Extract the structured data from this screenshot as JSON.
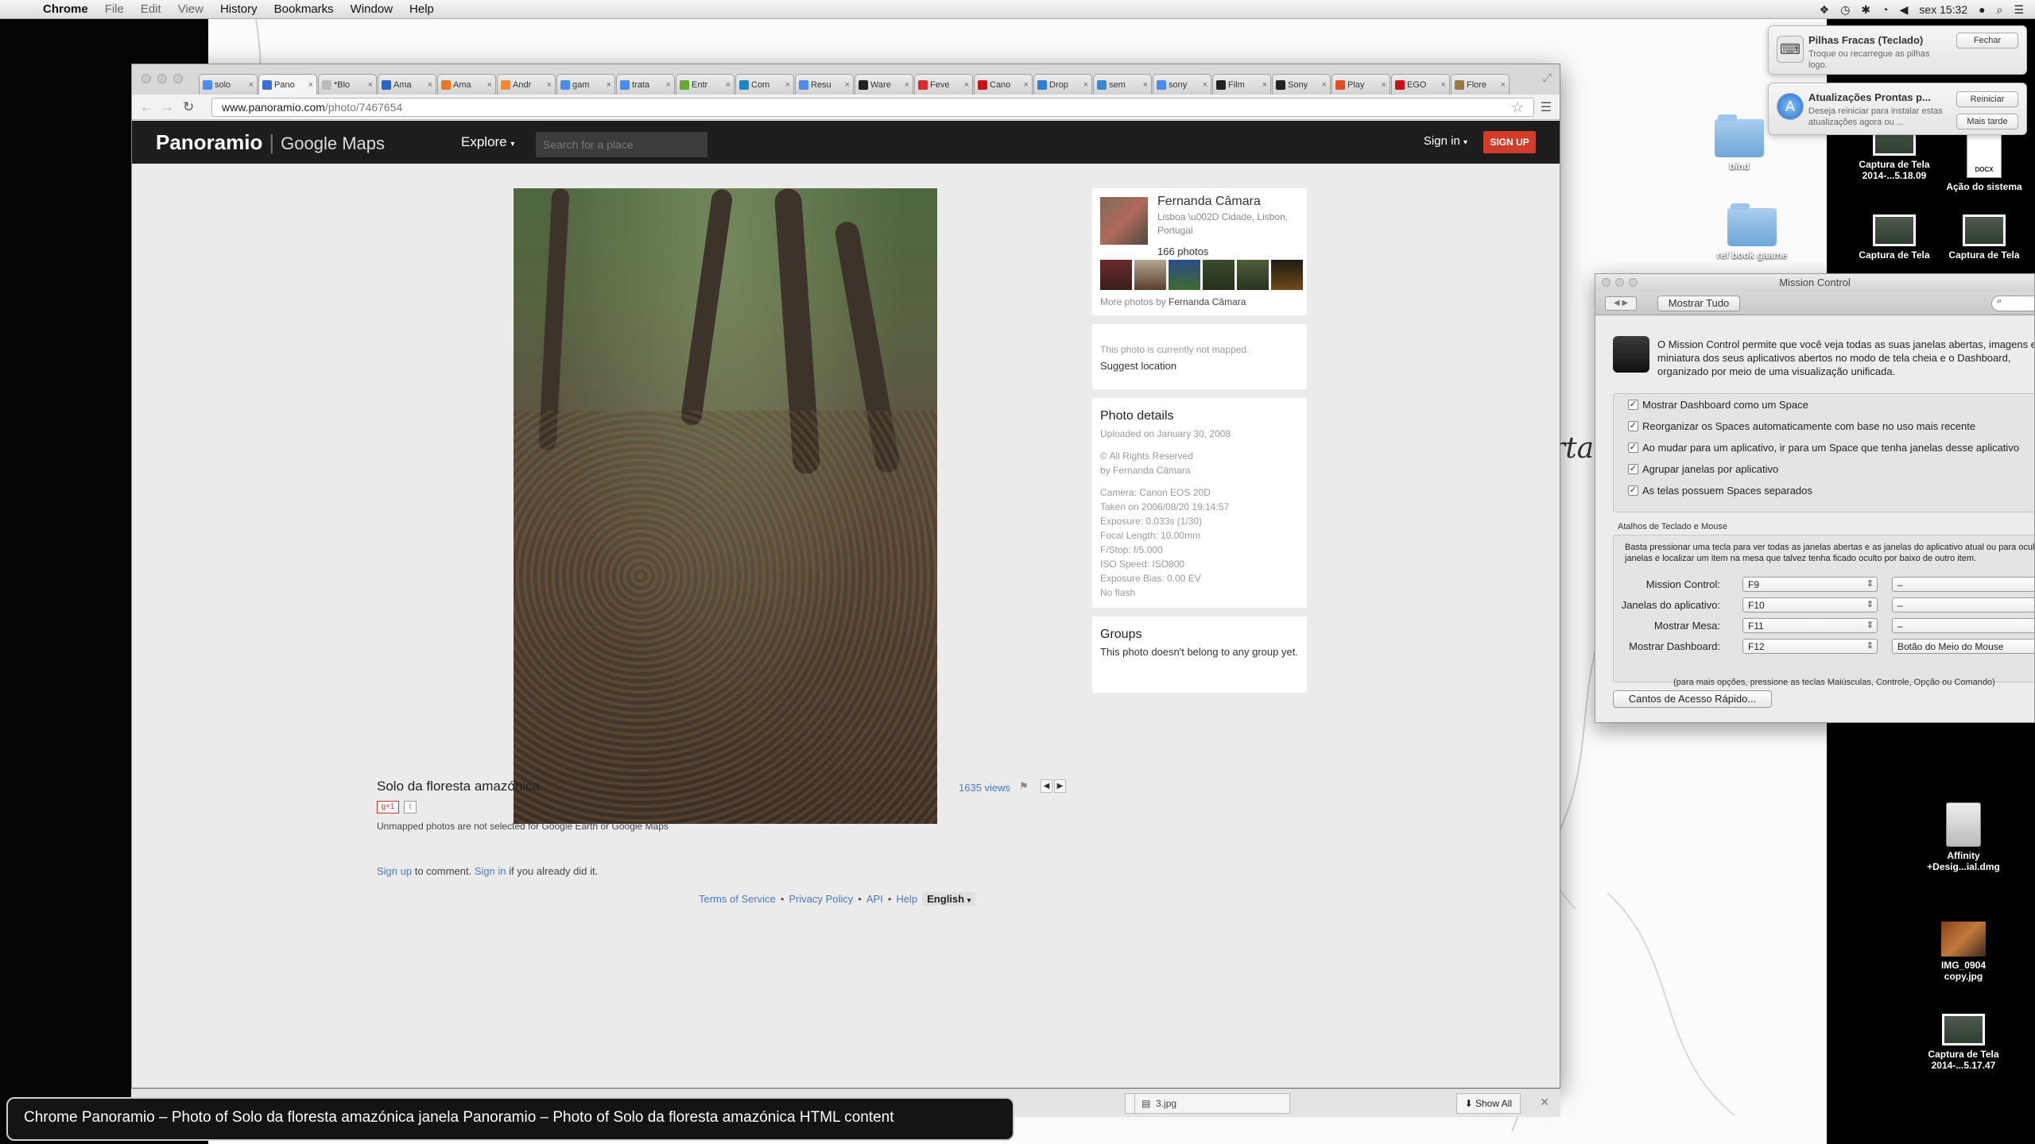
{
  "menubar": {
    "app": "Chrome",
    "items": [
      "File",
      "Edit",
      "View",
      "History",
      "Bookmarks",
      "Window",
      "Help"
    ],
    "clock": "sex 15:32"
  },
  "browser": {
    "tabs": [
      {
        "label": "solo",
        "color": "#4a8cf0"
      },
      {
        "label": "Pano",
        "color": "#3a6fd8"
      },
      {
        "label": "*Blo",
        "color": "#bbbbbb"
      },
      {
        "label": "Ama",
        "color": "#2a64c5"
      },
      {
        "label": "Ama",
        "color": "#e87722"
      },
      {
        "label": "Andr",
        "color": "#f28b30"
      },
      {
        "label": "gam",
        "color": "#4a8cf0"
      },
      {
        "label": "trata",
        "color": "#4a8cf0"
      },
      {
        "label": "Entr",
        "color": "#66aa33"
      },
      {
        "label": "Com",
        "color": "#1e88c7"
      },
      {
        "label": "Resu",
        "color": "#4a8cf0"
      },
      {
        "label": "Ware",
        "color": "#222222"
      },
      {
        "label": "Feve",
        "color": "#d62b2b"
      },
      {
        "label": "Cano",
        "color": "#cc1111"
      },
      {
        "label": "Drop",
        "color": "#2c7fd6"
      },
      {
        "label": "sem",
        "color": "#3a88cf"
      },
      {
        "label": "sony",
        "color": "#4a8cf0"
      },
      {
        "label": "Film",
        "color": "#222222"
      },
      {
        "label": "Sony",
        "color": "#222222"
      },
      {
        "label": "Play",
        "color": "#e44d26"
      },
      {
        "label": "EGO",
        "color": "#cc1111"
      },
      {
        "label": "Flore",
        "color": "#997744"
      }
    ],
    "url_host": "www.panoramio.com",
    "url_path": "/photo/7467654"
  },
  "panoramio": {
    "logo": "Panoramio",
    "logo_sub": "Google Maps",
    "explore": "Explore",
    "search_placeholder": "Search for a place",
    "sign_in": "Sign in",
    "sign_up": "SIGN UP",
    "photo_title": "Solo da floresta amazónica",
    "views": "1635 views",
    "gplus": "g+1",
    "unmapped_note": "Unmapped photos are not selected for Google Earth or Google Maps",
    "comment_signup": "Sign up",
    "comment_mid": " to comment. ",
    "comment_signin": "Sign in",
    "comment_end": " if you already did it.",
    "footer": {
      "tos": "Terms of Service",
      "privacy": "Privacy Policy",
      "api": "API",
      "help": "Help",
      "language": "English"
    },
    "user": {
      "name": "Fernanda Câmara",
      "location": "Lisboa \\u002D Cidade, Lisbon, Portugal",
      "count": "166 photos",
      "more_prefix": "More photos by ",
      "more_name": "Fernanda Câmara"
    },
    "location_card": {
      "not_mapped": "This photo is currently not mapped.",
      "suggest": "Suggest location"
    },
    "details": {
      "title": "Photo details",
      "uploaded": "Uploaded on January 30, 2008",
      "rights": "© All Rights Reserved",
      "by": "by Fernanda Câmara",
      "camera": "Camera: Canon EOS 20D",
      "taken": "Taken on 2006/08/20 19:14:57",
      "exposure": "Exposure: 0.033s (1/30)",
      "focal": "Focal Length: 10.00mm",
      "fstop": "F/Stop: f/5.000",
      "iso": "ISO Speed: ISO800",
      "bias": "Exposure Bias: 0.00 EV",
      "flash": "No flash"
    },
    "groups": {
      "title": "Groups",
      "text": "This photo doesn't belong to any group yet."
    }
  },
  "downloads": {
    "item": "3.jpg",
    "show_all": "Show All"
  },
  "voiceover": "Chrome Panoramio – Photo of Solo da floresta amazónica janela Panoramio – Photo of Solo da floresta amazónica HTML content",
  "notifications": [
    {
      "title": "Pilhas Fracas (Teclado)",
      "body": "Troque ou recarregue as pilhas logo.",
      "button": "Fechar"
    },
    {
      "title": "Atualizações Prontas p...",
      "body": "Deseja reiniciar para instalar estas atualizações agora ou ...",
      "button1": "Reiniciar",
      "button2": "Mais tarde"
    }
  ],
  "desktop": {
    "cursive": "rta,",
    "icons": [
      {
        "label": "bind"
      },
      {
        "label": "ref book gaame"
      },
      {
        "label": "Captura de Tela 2014-...5.18.09"
      },
      {
        "label": "Ação do sistema"
      },
      {
        "label": "Captura de Tela"
      },
      {
        "label": "Captura de Tela"
      },
      {
        "label": "Affinity +Desig...ial.dmg"
      },
      {
        "label": "IMG_0904 copy.jpg"
      },
      {
        "label": "Captura de Tela 2014-...5.17.47"
      }
    ],
    "docx": "DOCX"
  },
  "mission_control": {
    "title": "Mission Control",
    "show_all": "Mostrar Tudo",
    "desc": [
      "O Mission Control permite que você veja todas as suas janelas abertas, imagens em",
      "miniatura dos seus aplicativos abertos no modo de tela cheia e o Dashboard,",
      "organizado por meio de uma visualização unificada."
    ],
    "checkboxes": [
      "Mostrar Dashboard como um Space",
      "Reorganizar os Spaces automaticamente com base no uso mais recente",
      "Ao mudar para um aplicativo, ir para um Space que tenha janelas desse aplicativo",
      "Agrupar janelas por aplicativo",
      "As telas possuem Spaces separados"
    ],
    "shortcuts_title": "Atalhos de Teclado e Mouse",
    "shortcuts_desc": [
      "Basta pressionar uma tecla para ver todas as janelas abertas e as janelas do aplicativo atual ou para ocultar as",
      "janelas e localizar um item na mesa que talvez tenha ficado oculto por baixo de outro item."
    ],
    "rows": [
      {
        "label": "Mission Control:",
        "key": "F9",
        "mouse": "–"
      },
      {
        "label": "Janelas do aplicativo:",
        "key": "F10",
        "mouse": "–"
      },
      {
        "label": "Mostrar Mesa:",
        "key": "F11",
        "mouse": "–"
      },
      {
        "label": "Mostrar Dashboard:",
        "key": "F12",
        "mouse": "Botão do Meio do Mouse"
      }
    ],
    "note": "(para mais opções, pressione as teclas Maiúsculas, Controle, Opção ou Comando)",
    "corners_button": "Cantos de Acesso Rápido..."
  }
}
